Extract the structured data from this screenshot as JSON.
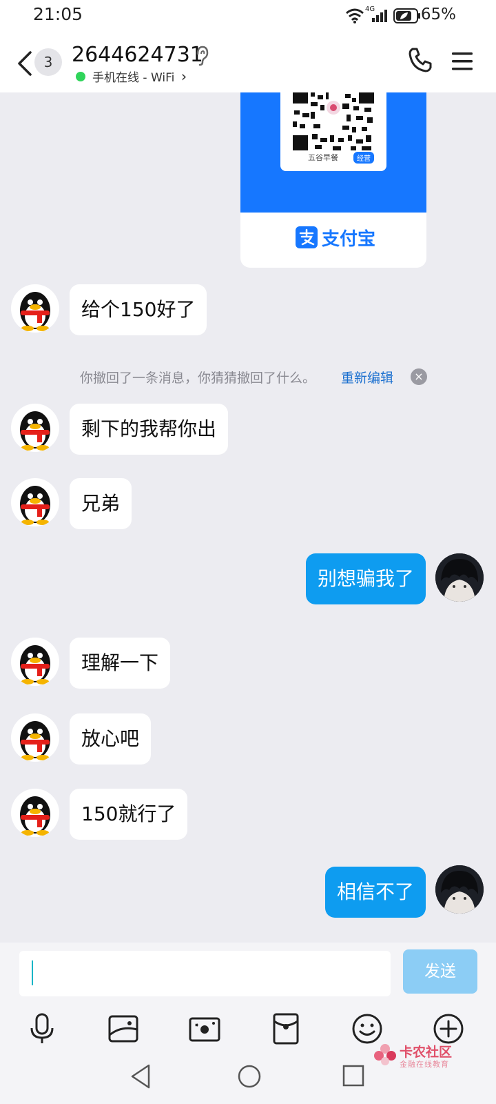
{
  "status_bar": {
    "time": "21:05",
    "battery": "65%",
    "network": "4G"
  },
  "header": {
    "unread_count": "3",
    "contact_name": "2644624731",
    "online_status": "手机在线 - WiFi",
    "status_arrow": "›"
  },
  "payment_card": {
    "shop_name": "五谷早餐",
    "tag": "经营",
    "brand": "支付宝"
  },
  "messages": [
    {
      "sender": "them",
      "text": "给个150好了"
    },
    {
      "sender": "them",
      "text": "剩下的我帮你出"
    },
    {
      "sender": "them",
      "text": "兄弟"
    },
    {
      "sender": "me",
      "text": "别想骗我了"
    },
    {
      "sender": "them",
      "text": "理解一下"
    },
    {
      "sender": "them",
      "text": "放心吧"
    },
    {
      "sender": "them",
      "text": "150就行了"
    },
    {
      "sender": "me",
      "text": "相信不了"
    }
  ],
  "recall_notice": {
    "text": "你撤回了一条消息，你猜猜撤回了什么。",
    "link": "重新编辑",
    "close": "×"
  },
  "composer": {
    "input_value": "",
    "send_label": "发送"
  },
  "toolbar_icons": [
    "microphone-icon",
    "image-icon",
    "camera-icon",
    "red-packet-icon",
    "emoji-icon",
    "plus-icon"
  ],
  "watermark": {
    "title": "卡农社区",
    "subtitle": "金融在线教育"
  },
  "colors": {
    "accent": "#0e9cf0",
    "send_disabled": "#8ccdf5",
    "alipay_blue": "#1677ff",
    "online": "#2fd45a"
  }
}
